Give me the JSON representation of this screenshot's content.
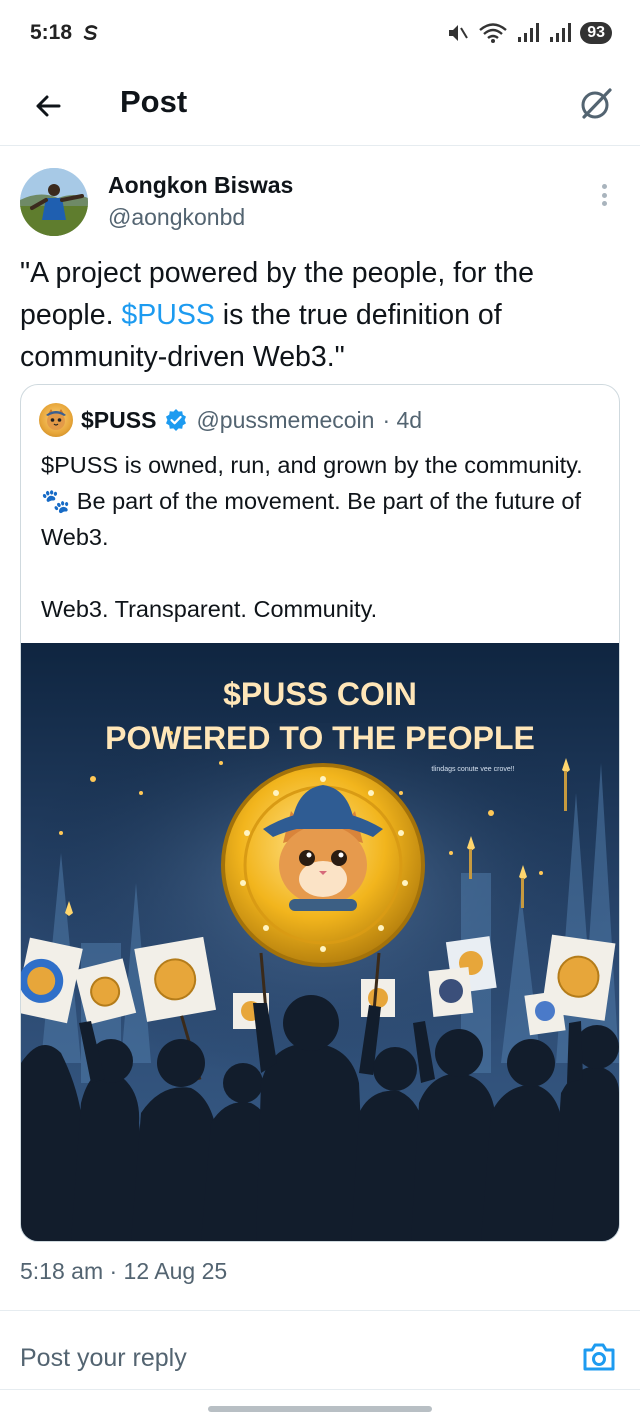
{
  "status_bar": {
    "time": "5:18",
    "battery": "93",
    "icons": [
      "s-app-icon",
      "mute-icon",
      "wifi-icon",
      "signal-icon",
      "signal-icon"
    ]
  },
  "header": {
    "title": "Post",
    "back_icon": "arrow-left-icon",
    "grok_icon": "grok-icon"
  },
  "author": {
    "name": "Aongkon Biswas",
    "handle": "@aongkonbd"
  },
  "post": {
    "text_before": "\"A project powered by the people, for the people. ",
    "cashtag": "$PUSS",
    "text_after": " is the true definition of community-driven Web3.\""
  },
  "quote": {
    "name": "$PUSS",
    "handle": "@pussmemecoin",
    "age": "· 4d",
    "verified": true,
    "body_line1_before": "$PUSS is owned, run, and grown by the community. ",
    "emoji": "🐾",
    "body_line1_after": " Be part of the movement. Be part of the future of Web3.",
    "body_line2": "Web3. Transparent. Community.",
    "image": {
      "title_line1": "$PUSS COIN",
      "title_line2": "POWERED TO THE PEOPLE",
      "small_caption": "tlindags conute vee crove!!",
      "colors": {
        "sky_top": "#0f2540",
        "sky_bottom": "#3a5f8a",
        "coin": "#f2b51d",
        "hat": "#2f5c93"
      }
    }
  },
  "timestamp": "5:18 am · 12 Aug 25",
  "reply": {
    "placeholder": "Post your reply",
    "camera_icon": "camera-icon"
  },
  "colors": {
    "link": "#1d9bf0",
    "text": "#0f1419",
    "secondary": "#536471",
    "border": "#cfd9de"
  }
}
